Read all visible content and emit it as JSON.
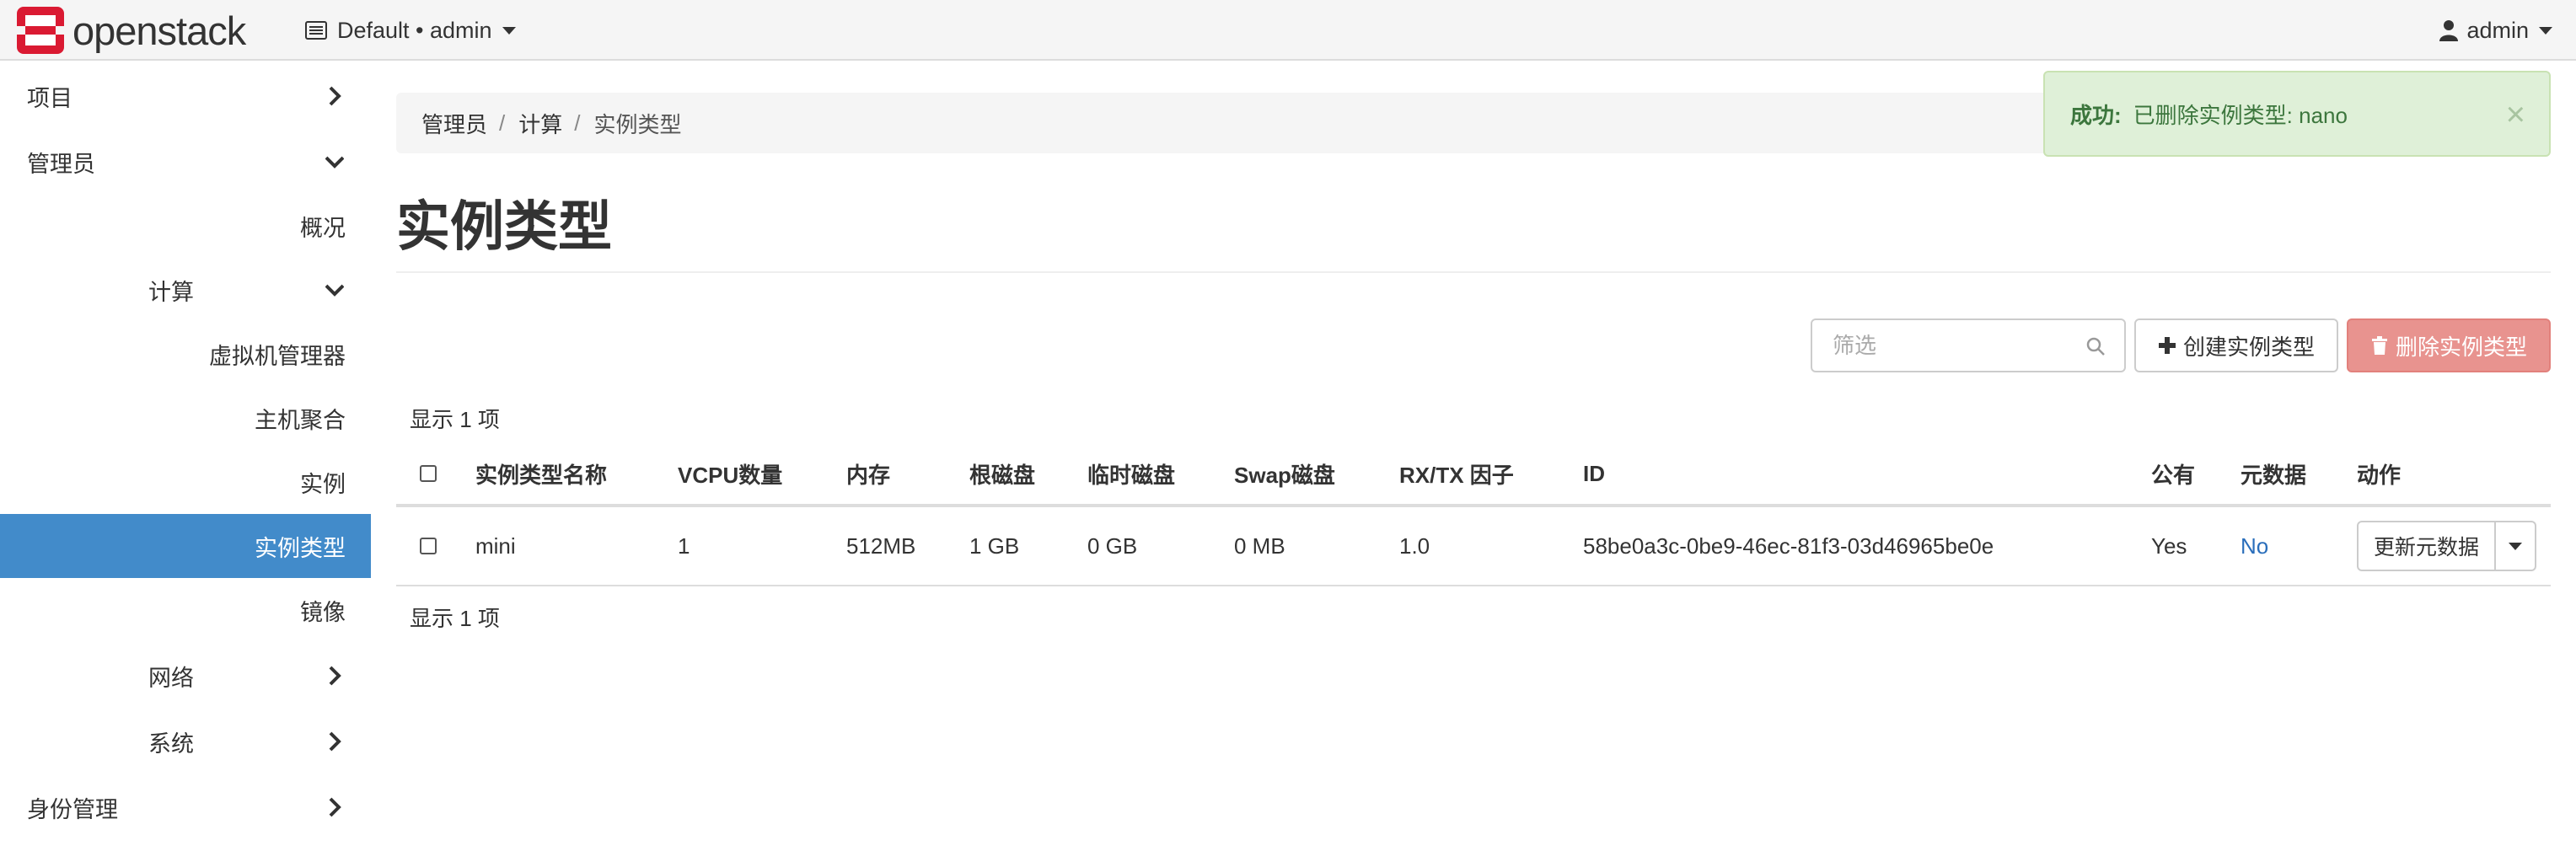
{
  "navbar": {
    "brand": "openstack",
    "project_switcher": "Default • admin",
    "user": "admin"
  },
  "sidebar": {
    "items": [
      {
        "label": "项目",
        "level": 0,
        "chevron": "right"
      },
      {
        "label": "管理员",
        "level": 0,
        "chevron": "down"
      },
      {
        "label": "概况",
        "level": 2
      },
      {
        "label": "计算",
        "level": 1,
        "chevron": "down"
      },
      {
        "label": "虚拟机管理器",
        "level": 2
      },
      {
        "label": "主机聚合",
        "level": 2
      },
      {
        "label": "实例",
        "level": 2
      },
      {
        "label": "实例类型",
        "level": 2,
        "active": true
      },
      {
        "label": "镜像",
        "level": 2
      },
      {
        "label": "网络",
        "level": 1,
        "chevron": "right"
      },
      {
        "label": "系统",
        "level": 1,
        "chevron": "right"
      },
      {
        "label": "身份管理",
        "level": 0,
        "chevron": "right"
      }
    ]
  },
  "breadcrumb": {
    "items": [
      "管理员",
      "计算",
      "实例类型"
    ],
    "separator": "/"
  },
  "page": {
    "title": "实例类型"
  },
  "alert": {
    "label": "成功:",
    "message": "已删除实例类型: nano",
    "close": "×"
  },
  "toolbar": {
    "filter_placeholder": "筛选",
    "create_label": "创建实例类型",
    "delete_label": "删除实例类型"
  },
  "table": {
    "count_text": "显示 1 项",
    "columns": [
      "实例类型名称",
      "VCPU数量",
      "内存",
      "根磁盘",
      "临时磁盘",
      "Swap磁盘",
      "RX/TX 因子",
      "ID",
      "公有",
      "元数据",
      "动作"
    ],
    "rows": [
      {
        "name": "mini",
        "vcpus": "1",
        "ram": "512MB",
        "root_disk": "1 GB",
        "ephemeral_disk": "0 GB",
        "swap_disk": "0 MB",
        "rxtx_factor": "1.0",
        "id": "58be0a3c-0be9-46ec-81f3-03d46965be0e",
        "public": "Yes",
        "metadata": "No",
        "action": "更新元数据"
      }
    ]
  },
  "colors": {
    "accent": "#428bca",
    "brand_red": "#da1a32",
    "success_bg": "#dff0d8",
    "success_text": "#3c763d",
    "danger_button": "#e8938f",
    "link": "#2a6ebb"
  },
  "icons": {
    "logo": "openstack-logo-icon",
    "project": "project-icon",
    "user": "user-icon",
    "search": "search-icon",
    "create": "plus-icon",
    "delete": "trash-icon",
    "chevron_right": "chevron-right-icon",
    "chevron_down": "chevron-down-icon"
  }
}
